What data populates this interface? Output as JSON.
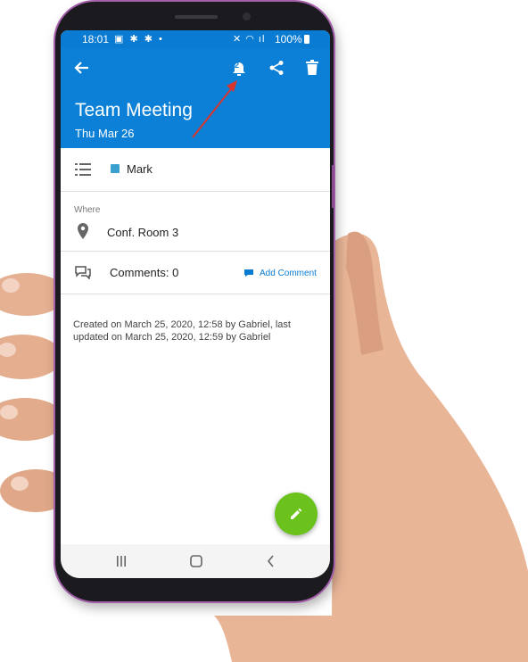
{
  "status": {
    "time": "18:01",
    "battery": "100%"
  },
  "header": {
    "title": "Team Meeting",
    "date": "Thu Mar 26",
    "reminder_count": "2"
  },
  "category": {
    "label": "Mark",
    "color": "#3aa0cf"
  },
  "where": {
    "label": "Where",
    "value": "Conf. Room 3"
  },
  "comments": {
    "label": "Comments: 0",
    "add_label": "Add Comment"
  },
  "meta": {
    "text": "Created on March 25, 2020, 12:58 by Gabriel, last updated on March 25, 2020, 12:59 by Gabriel"
  },
  "colors": {
    "header": "#0b80d6",
    "fab": "#6cc21c",
    "accent": "#0a7bd2",
    "annotation_arrow": "#d9342b"
  },
  "icons": [
    "back-arrow-icon",
    "bell-icon",
    "share-icon",
    "trash-icon",
    "list-icon",
    "map-pin-icon",
    "comments-icon",
    "chat-bubble-icon",
    "pencil-icon",
    "recents-icon",
    "home-icon",
    "back-icon"
  ]
}
